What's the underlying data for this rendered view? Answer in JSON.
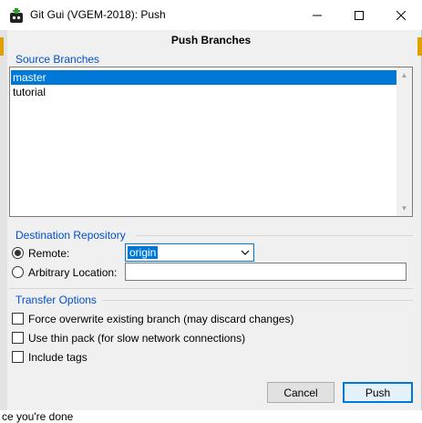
{
  "window": {
    "title": "Git Gui (VGEM-2018): Push",
    "minimize_symbol": "—",
    "maximize_symbol": "☐",
    "close_symbol": "✕"
  },
  "dialog": {
    "heading": "Push Branches"
  },
  "source_branches": {
    "label": "Source Branches",
    "items": [
      {
        "label": "master",
        "selected": true
      },
      {
        "label": "tutorial",
        "selected": false
      }
    ],
    "scroll_up_icon": "▲",
    "scroll_down_icon": "▼"
  },
  "destination": {
    "label": "Destination Repository",
    "remote_label": "Remote:",
    "remote_value": "origin",
    "remote_checked": true,
    "arbitrary_label": "Arbitrary Location:",
    "arbitrary_value": "",
    "arbitrary_checked": false
  },
  "transfer_options": {
    "label": "Transfer Options",
    "force_label": "Force overwrite existing branch (may discard changes)",
    "thin_pack_label": "Use thin pack (for slow network connections)",
    "include_tags_label": "Include tags"
  },
  "buttons": {
    "cancel": "Cancel",
    "push": "Push"
  },
  "background_text": "ce you're  done",
  "colors": {
    "accent": "#0078d7",
    "group_label": "#0050c8",
    "orange_strip": "#e0a000"
  }
}
